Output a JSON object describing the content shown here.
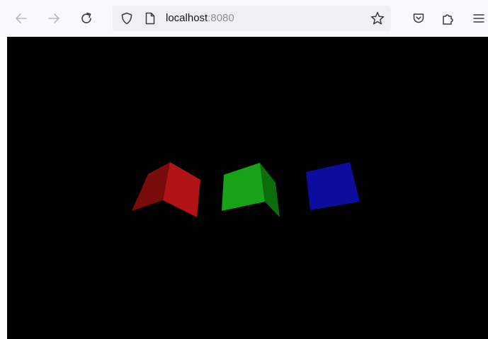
{
  "browser": {
    "url_host": "localhost",
    "url_port": ":8080"
  },
  "toolbar": {
    "icons": {
      "back": "arrow-left-icon",
      "forward": "arrow-right-icon",
      "reload": "reload-icon",
      "tracking": "shield-icon",
      "page": "page-icon",
      "bookmark": "star-icon",
      "pocket": "pocket-icon",
      "extensions": "puzzle-icon",
      "menu": "hamburger-menu-icon"
    }
  },
  "scene": {
    "background_color": "#000000",
    "cubes": [
      {
        "name": "red-cube",
        "color_light": "#b01414",
        "color_dark": "#7a0b0b"
      },
      {
        "name": "green-cube",
        "color_light": "#17a317",
        "color_dark": "#0d6d0d"
      },
      {
        "name": "blue-cube",
        "color_light": "#0c0c9e",
        "color_dark": "#0c0c9e"
      }
    ]
  }
}
